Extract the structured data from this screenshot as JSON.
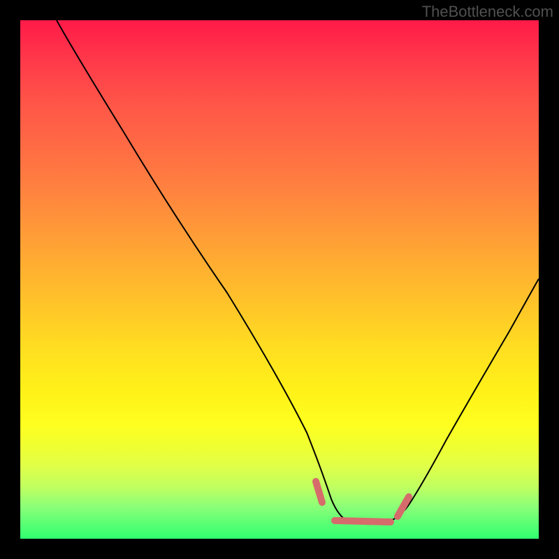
{
  "watermark": "TheBottleneck.com",
  "chart_data": {
    "type": "line",
    "title": "",
    "xlabel": "",
    "ylabel": "",
    "xlim": [
      0,
      100
    ],
    "ylim": [
      0,
      100
    ],
    "series": [
      {
        "name": "curve",
        "x": [
          7,
          12,
          20,
          30,
          40,
          50,
          55,
          58,
          60,
          65,
          70,
          72,
          75,
          80,
          88,
          95,
          100
        ],
        "y": [
          100,
          92,
          79,
          63,
          47,
          30,
          18,
          10,
          6,
          3,
          3,
          4,
          7,
          15,
          30,
          45,
          55
        ]
      }
    ],
    "annotations": [
      {
        "name": "marker-bottom",
        "color": "#d87070",
        "segments": [
          {
            "x1": 57,
            "y1": 11,
            "x2": 58,
            "y2": 6
          },
          {
            "x1": 60,
            "y1": 3,
            "x2": 71,
            "y2": 3
          },
          {
            "x1": 72,
            "y1": 4,
            "x2": 74,
            "y2": 8
          }
        ]
      }
    ],
    "gradient_stops": [
      {
        "pos": 0,
        "color": "#ff1a48"
      },
      {
        "pos": 50,
        "color": "#ffb030"
      },
      {
        "pos": 80,
        "color": "#feff20"
      },
      {
        "pos": 100,
        "color": "#30ff70"
      }
    ]
  }
}
